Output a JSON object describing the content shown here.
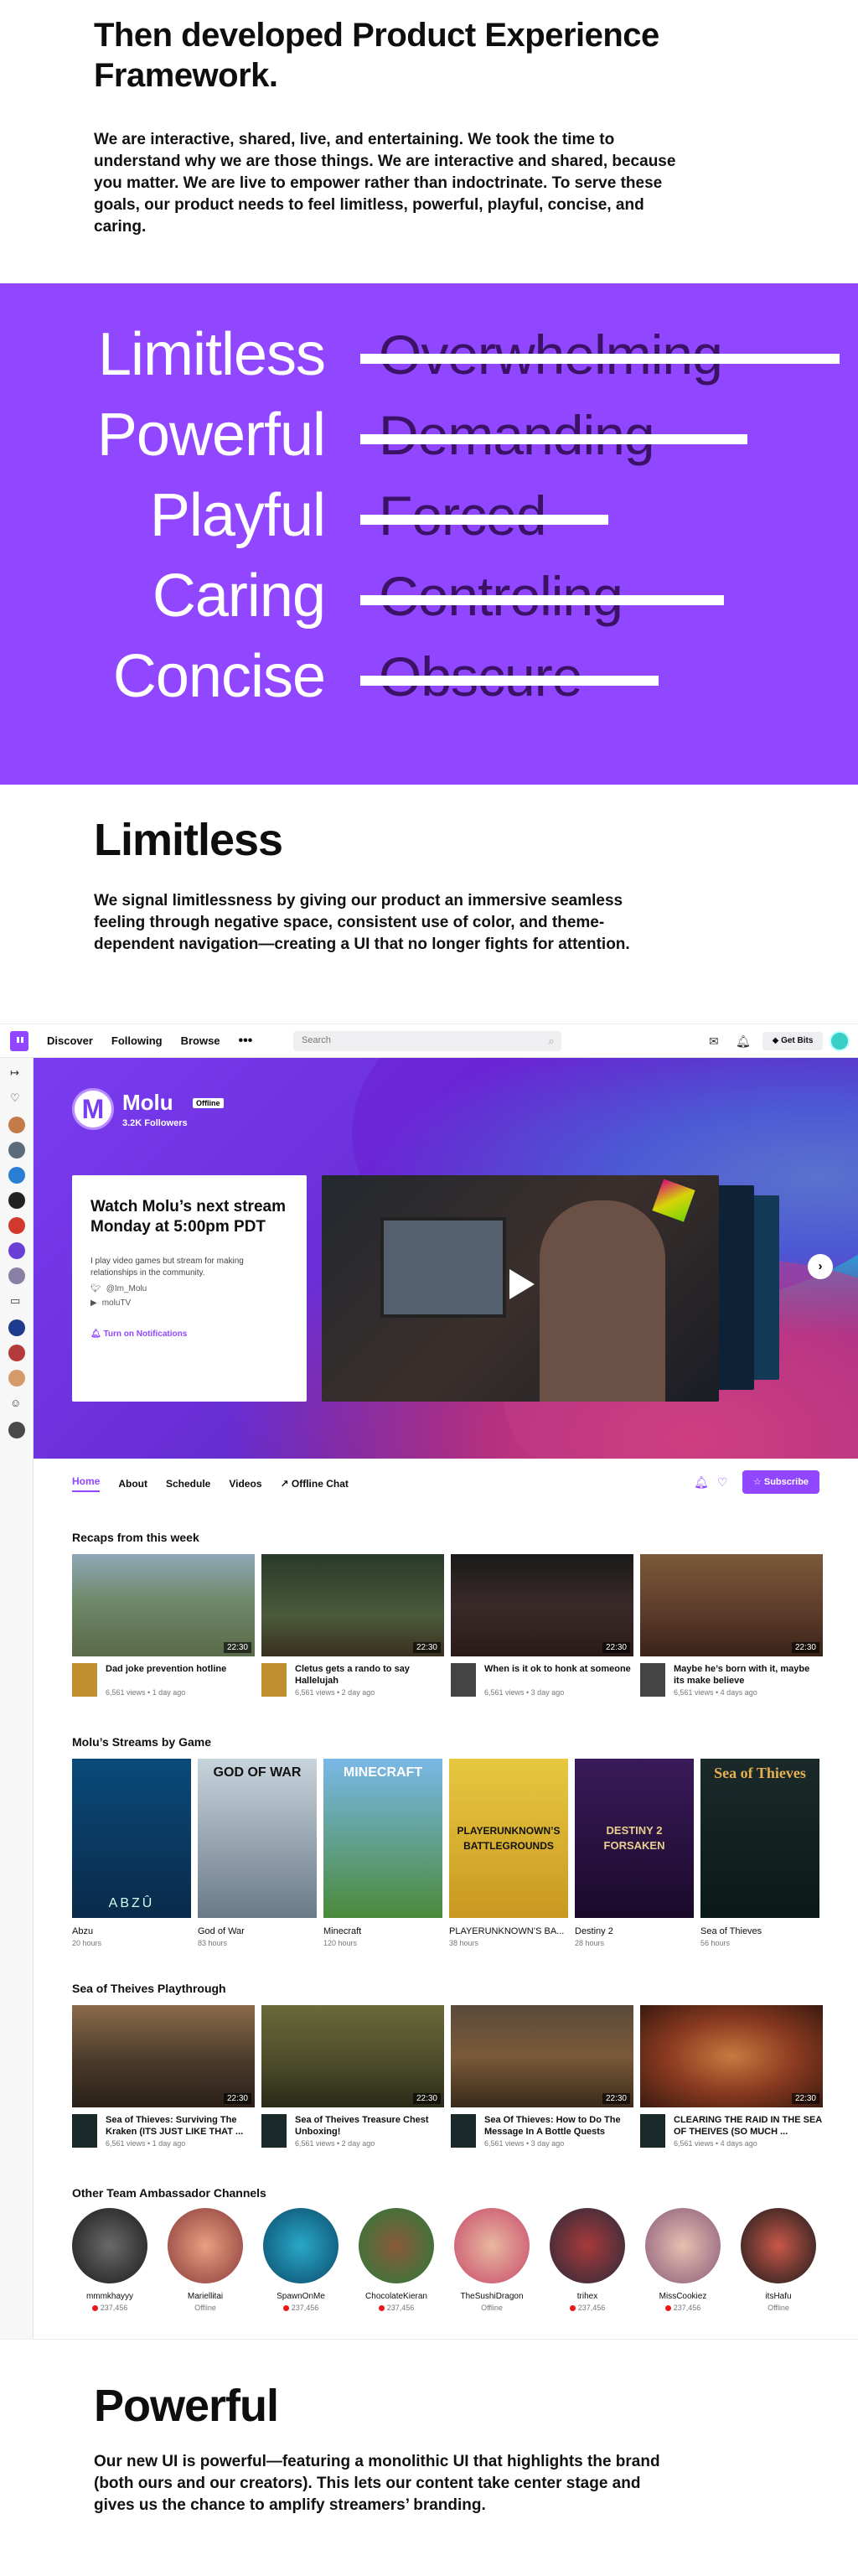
{
  "framework": {
    "heading": "Then developed Product Experience Framework.",
    "body": "We are interactive, shared, live, and entertaining.  We took the time to understand why we are those things. We are interactive and shared, because you matter. We are live to empower rather than indoctrinate. To serve these goals, our product needs to feel limitless, powerful, playful, concise, and caring."
  },
  "principles": [
    {
      "positive": "Limitless",
      "negative": "Overwhelming"
    },
    {
      "positive": "Powerful",
      "negative": "Demanding"
    },
    {
      "positive": "Playful",
      "negative": "Forced"
    },
    {
      "positive": "Caring",
      "negative": "Controling"
    },
    {
      "positive": "Concise",
      "negative": "Obscure"
    }
  ],
  "colors": {
    "brand_purple": "#9146ff",
    "text_dark": "#0e0e10",
    "negative_text": "#3b1266",
    "live_red": "#e91916"
  },
  "limitless": {
    "heading": "Limitless",
    "body": "We signal limitlessness by giving our product an immersive seamless feeling through negative space, consistent use of color, and theme-dependent navigation—creating a UI that no longer fights for attention."
  },
  "powerful": {
    "heading": "Powerful",
    "body": "Our new UI is powerful—featuring a monolithic UI that highlights the brand (both ours and our creators). This lets our content take center stage and gives us the chance to amplify streamers’ branding."
  },
  "mockup": {
    "nav": {
      "logo_icon": "twitch-logo-icon",
      "links": [
        "Discover",
        "Following",
        "Browse"
      ],
      "more": "•••",
      "search_placeholder": "Search",
      "get_bits": "Get Bits"
    },
    "channel": {
      "name": "Molu",
      "avatar_letter": "M",
      "status": "Offline",
      "followers": "3.2K Followers",
      "offline_title": "Watch Molu’s next stream Monday at 5:00pm PDT",
      "offline_desc": "I play video games but stream for making relationships in the community.",
      "twitter": "@Im_Molu",
      "youtube": "moluTV",
      "notify": "Turn on Notifications"
    },
    "tabs": [
      "Home",
      "About",
      "Schedule",
      "Videos",
      "Offline Chat"
    ],
    "subscribe": "Subscribe",
    "recaps": {
      "title": "Recaps from this week",
      "items": [
        {
          "title": "Dad joke prevention hotline",
          "meta": "6,561 views • 1 day ago",
          "duration": "22:30"
        },
        {
          "title": "Cletus gets a rando to say Hallelujah",
          "meta": "6,561 views • 2 day ago",
          "duration": "22:30"
        },
        {
          "title": "When is it ok to honk at someone",
          "meta": "6,561 views • 3 day ago",
          "duration": "22:30"
        },
        {
          "title": "Maybe he’s born with it, maybe its make believe",
          "meta": "6,561 views • 4 days ago",
          "duration": "22:30"
        }
      ]
    },
    "games": {
      "title": "Molu’s Streams by Game",
      "items": [
        {
          "name": "Abzu",
          "hours": "20 hours",
          "cover": "ABZÛ"
        },
        {
          "name": "God of War",
          "hours": "83 hours",
          "cover": "GOD OF WAR"
        },
        {
          "name": "Minecraft",
          "hours": "120 hours",
          "cover": "MINECRAFT"
        },
        {
          "name": "PLAYERUNKNOWN’S BA...",
          "hours": "38 hours",
          "cover": "PLAYERUNKNOWN’S BATTLEGROUNDS"
        },
        {
          "name": "Destiny 2",
          "hours": "28 hours",
          "cover": "DESTINY 2 FORSAKEN"
        },
        {
          "name": "Sea of Thieves",
          "hours": "56 hours",
          "cover": "Sea of Thieves"
        }
      ]
    },
    "playthrough": {
      "title": "Sea of Theives Playthrough",
      "items": [
        {
          "title": "Sea of Thieves: Surviving The Kraken (ITS JUST LIKE THAT ...",
          "meta": "6,561 views • 1 day ago",
          "duration": "22:30"
        },
        {
          "title": "Sea of Theives Treasure Chest Unboxing!",
          "meta": "6,561 views • 2 day ago",
          "duration": "22:30"
        },
        {
          "title": "Sea Of Thieves: How to Do The Message In A Bottle Quests",
          "meta": "6,561 views • 3 day ago",
          "duration": "22:30"
        },
        {
          "title": "CLEARING THE RAID IN THE SEA OF THEIVES (SO MUCH ...",
          "meta": "6,561 views • 4 days ago",
          "duration": "22:30"
        }
      ]
    },
    "ambassadors": {
      "title": "Other Team Ambassador Channels",
      "items": [
        {
          "name": "mmmkhayyy",
          "status": "237,456",
          "live": true
        },
        {
          "name": "Mariellitai",
          "status": "Offline",
          "live": false
        },
        {
          "name": "SpawnOnMe",
          "status": "237,456",
          "live": true
        },
        {
          "name": "ChocolateKieran",
          "status": "237,456",
          "live": true
        },
        {
          "name": "TheSushiDragon",
          "status": "Offline",
          "live": false
        },
        {
          "name": "trihex",
          "status": "237,456",
          "live": true
        },
        {
          "name": "MissCookiez",
          "status": "237,456",
          "live": true
        },
        {
          "name": "itsHafu",
          "status": "Offline",
          "live": false
        }
      ]
    }
  }
}
